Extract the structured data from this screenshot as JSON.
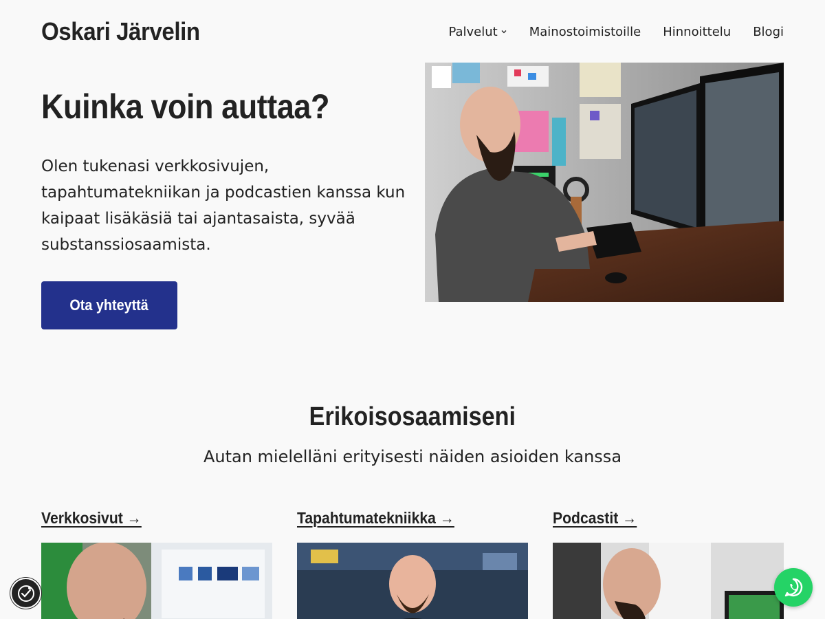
{
  "header": {
    "site_title": "Oskari Järvelin",
    "nav": [
      {
        "label": "Palvelut",
        "has_dropdown": true
      },
      {
        "label": "Mainostoimistoille"
      },
      {
        "label": "Hinnoittelu"
      },
      {
        "label": "Blogi"
      }
    ]
  },
  "hero": {
    "title": "Kuinka voin auttaa?",
    "text": "Olen tukenasi verkkosivujen, tapahtumatekniikan ja podcastien kanssa kun kaipaat lisäkäsiä tai ajantasaista, syvää substanssiosaamista.",
    "cta_label": "Ota yhteyttä"
  },
  "section": {
    "title": "Erikoisosaamiseni",
    "subtitle": "Autan mielelläni erityisesti näiden asioiden kanssa",
    "cards": [
      {
        "label": "Verkkosivut →"
      },
      {
        "label": "Tapahtumatekniikka →"
      },
      {
        "label": "Podcastit →"
      }
    ]
  },
  "colors": {
    "background": "#f9f9f9",
    "text": "#222222",
    "accent": "#23318c",
    "whatsapp": "#25d366"
  },
  "icons": {
    "dropdown": "chevron-down-icon",
    "accessibility": "accessibility-icon",
    "whatsapp": "whatsapp-icon"
  }
}
